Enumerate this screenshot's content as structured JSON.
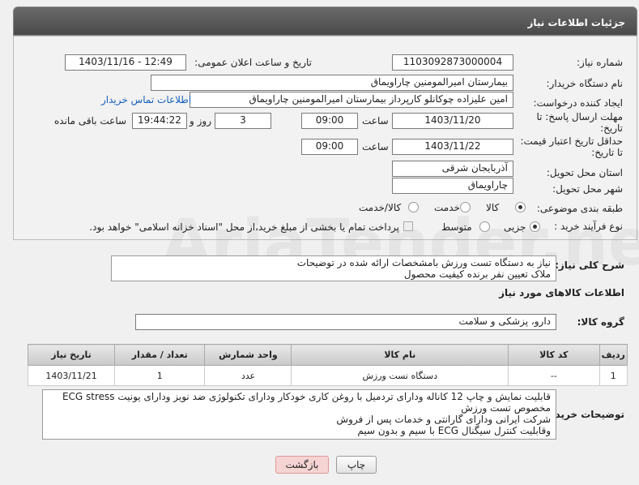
{
  "header": {
    "title": "جزئیات اطلاعات نیاز"
  },
  "fields": {
    "need_number_label": "شماره نیاز:",
    "need_number": "1103092873000004",
    "announce_label": "تاریخ و ساعت اعلان عمومی:",
    "announce_value": "1403/11/16 - 12:49",
    "buyer_org_label": "نام دستگاه خریدار:",
    "buyer_org": "بیمارستان امیرالمومنین چاراویماق",
    "creator_label": "ایجاد کننده درخواست:",
    "creator": "امین علیزاده چوکانلو کارپرداز بیمارستان امیرالمومنین چاراویماق",
    "contact_link": "اطلاعات تماس خریدار",
    "deadline_label": "مهلت ارسال پاسخ: تا تاریخ:",
    "deadline_date": "1403/11/20",
    "time_label": "ساعت",
    "deadline_time": "09:00",
    "days_value": "3",
    "days_label": "روز و",
    "remaining_time": "19:44:22",
    "remaining_label": "ساعت باقی مانده",
    "price_validity_label": "حداقل تاریخ اعتبار قیمت: تا تاریخ:",
    "price_date": "1403/11/22",
    "price_time": "09:00",
    "province_label": "استان محل تحویل:",
    "province": "آذربایجان شرقی",
    "city_label": "شهر محل تحویل:",
    "city": "چاراویماق",
    "category_label": "طبقه بندی موضوعی:",
    "category_options": [
      "کالا",
      "خدمت",
      "کالا/خدمت"
    ],
    "process_label": "نوع فرآیند خرید :",
    "process_options": [
      "جزیی",
      "متوسط"
    ],
    "payment_note": "پرداخت تمام یا بخشی از مبلغ خرید،از محل \"اسناد خزانه اسلامی\" خواهد بود."
  },
  "description": {
    "label": "شرح کلی نیاز:",
    "line1": "نیاز به دستگاه تست ورزش بامشخصات ارائه شده در توضیحات",
    "line2": "ملاک تعیین نفر برنده کیفیت محصول"
  },
  "goods_info": {
    "title": "اطلاعات کالاهای مورد نیاز",
    "group_label": "گروه کالا:",
    "group_value": "دارو، پزشکی و سلامت"
  },
  "table": {
    "headers": [
      "ردیف",
      "کد کالا",
      "نام کالا",
      "واحد شمارش",
      "تعداد / مقدار",
      "تاریخ نیاز"
    ],
    "rows": [
      [
        "1",
        "--",
        "دستگاه تست ورزش",
        "عدد",
        "1",
        "1403/11/21"
      ]
    ]
  },
  "buyer_notes": {
    "label": "توضیحات خریدار:",
    "lines": [
      "قابلیت نمایش و چاپ 12 کاناله ودارای تردمیل با روغن کاری خودکار ودارای تکنولوژی ضد نویز ودارای یونیت ECG stress",
      "مخصوص تست ورزش",
      "شرکت ایرانی ودارای گارانتی و خدمات پس از فروش",
      "وقابلیت کنترل سیگنال ECG  با سیم و بدون سیم"
    ]
  },
  "buttons": {
    "print": "چاپ",
    "back": "بازگشت"
  },
  "watermark": "AriaTender.neT",
  "colors": {
    "link": "#1560bd",
    "back_button": "#f6d4d4"
  }
}
